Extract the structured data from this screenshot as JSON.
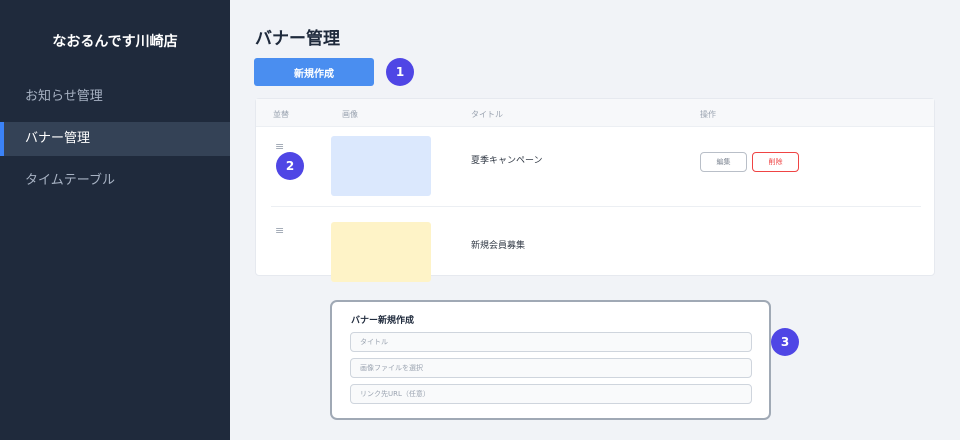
{
  "sidebar": {
    "brand": "なおるんです川崎店",
    "items": [
      {
        "label": "お知らせ管理",
        "active": false
      },
      {
        "label": "バナー管理",
        "active": true
      },
      {
        "label": "タイムテーブル",
        "active": false
      }
    ]
  },
  "main": {
    "title": "バナー管理",
    "new_button_label": "新規作成",
    "table": {
      "headers": {
        "order": "並替",
        "image": "画像",
        "title": "タイトル",
        "actions": "操作"
      },
      "rows": [
        {
          "handle": "≡",
          "title": "夏季キャンペーン",
          "thumb_color": "#dbe8fd",
          "edit_label": "編集",
          "delete_label": "削除"
        },
        {
          "handle": "≡",
          "title": "新規会員募集",
          "thumb_color": "#fef3c7"
        }
      ]
    },
    "form": {
      "title": "バナー新規作成",
      "title_placeholder": "タイトル",
      "image_placeholder": "画像ファイルを選択",
      "link_placeholder": "リンク先URL（任意）"
    }
  },
  "annotations": [
    "1",
    "2",
    "3"
  ],
  "colors": {
    "sidebar_bg": "#1f2a3c",
    "accent": "#4a8ef0",
    "badge": "#4f46e5",
    "danger": "#ef4444"
  }
}
